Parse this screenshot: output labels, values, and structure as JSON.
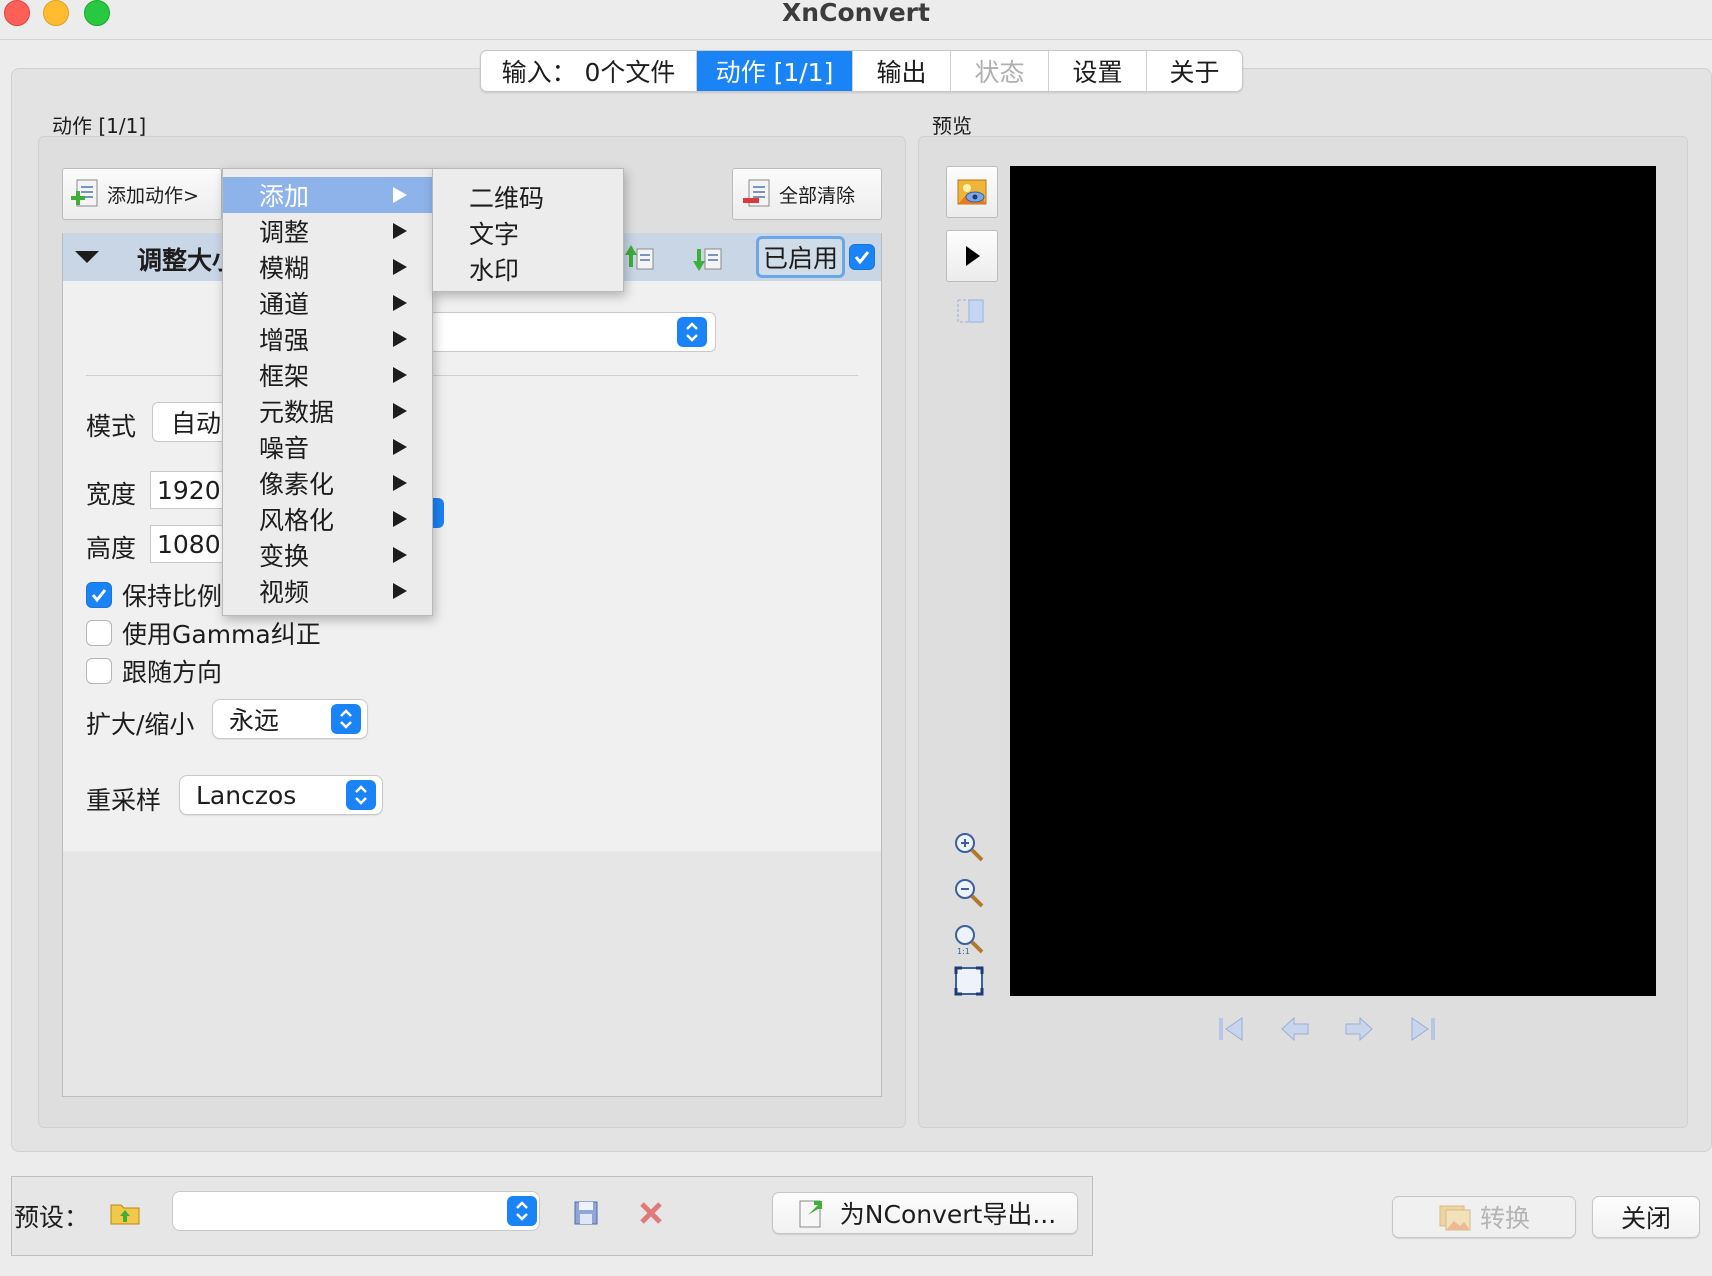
{
  "window": {
    "title": "XnConvert"
  },
  "tabs": [
    {
      "label": "输入：  0个文件"
    },
    {
      "label": "动作 [1/1]",
      "active": true
    },
    {
      "label": "输出"
    },
    {
      "label": "状态",
      "disabled": true
    },
    {
      "label": "设置"
    },
    {
      "label": "关于"
    }
  ],
  "actions_panel": {
    "title": "动作 [1/1]",
    "add_action_label": "添加动作>",
    "clear_all_label": "全部清除",
    "action": {
      "title": "调整大小",
      "enabled_label": "已启用",
      "enabled": true
    },
    "fields": {
      "mode_label": "模式",
      "mode_value": "自动",
      "width_label": "宽度",
      "width_value": "1920",
      "height_label": "高度",
      "height_value": "1080"
    },
    "checkboxes": [
      {
        "label": "保持比例",
        "checked": true
      },
      {
        "label": "使用Gamma纠正",
        "checked": false
      },
      {
        "label": "跟随方向",
        "checked": false
      }
    ],
    "enlarge_label": "扩大/缩小",
    "enlarge_value": "永远",
    "resample_label": "重采样",
    "resample_value": "Lanczos"
  },
  "preview": {
    "title": "预览"
  },
  "bottom": {
    "preset_label": "预设：",
    "export_label": "为NConvert导出...",
    "convert_label": "转换",
    "close_label": "关闭"
  },
  "context_menu": {
    "items": [
      {
        "label": "添加",
        "highlighted": true
      },
      {
        "label": "调整"
      },
      {
        "label": "模糊"
      },
      {
        "label": "通道"
      },
      {
        "label": "增强"
      },
      {
        "label": "框架"
      },
      {
        "label": "元数据"
      },
      {
        "label": "噪音"
      },
      {
        "label": "像素化"
      },
      {
        "label": "风格化"
      },
      {
        "label": "变换"
      },
      {
        "label": "视频"
      }
    ],
    "submenu": [
      {
        "label": "二维码"
      },
      {
        "label": "文字"
      },
      {
        "label": "水印"
      }
    ]
  },
  "colors": {
    "accent": "#1a83f5",
    "menu_highlight": "#8eb2ea",
    "action_header": "#c9d6e6",
    "preview_bg": "#000000"
  }
}
